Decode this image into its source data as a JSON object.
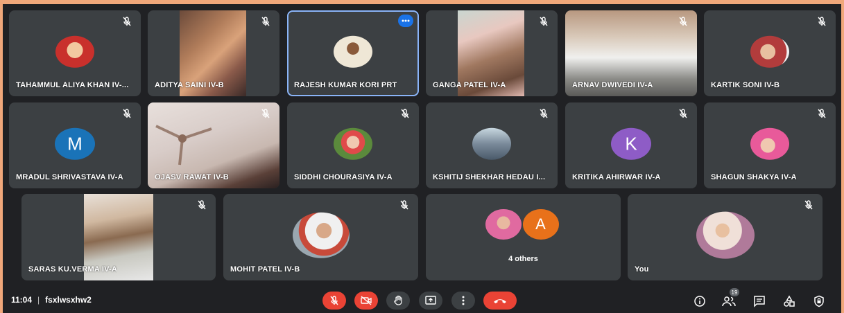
{
  "participants_row1": [
    {
      "name": "TAHAMMUL ALIYA KHAN IV-...",
      "avatar_color": "#c9302c"
    },
    {
      "name": "ADITYA SAINI IV-B"
    },
    {
      "name": "RAJESH KUMAR KORI PRT",
      "avatar_color": "#d8c9a7"
    },
    {
      "name": "GANGA PATEL IV-A"
    },
    {
      "name": "ARNAV DWIVEDI IV-A"
    },
    {
      "name": "KARTIK SONI IV-B",
      "avatar_color": "#b23c3c"
    }
  ],
  "participants_row2": [
    {
      "name": "MRADUL SHRIVASTAVA IV-A",
      "initial": "M",
      "avatar_color": "#1a73b8"
    },
    {
      "name": "OJASV RAWAT IV-B"
    },
    {
      "name": "SIDDHI CHOURASIYA IV-A",
      "avatar_color": "#5b8a3c"
    },
    {
      "name": "KSHITIJ SHEKHAR HEDAU I...",
      "avatar_color": "#7a8a9a"
    },
    {
      "name": "KRITIKA AHIRWAR IV-A",
      "initial": "K",
      "avatar_color": "#8e5cc6"
    },
    {
      "name": "SHAGUN SHAKYA IV-A",
      "avatar_color": "#e85a9a"
    }
  ],
  "participants_row3": [
    {
      "name": "SARAS KU.VERMA IV-A"
    },
    {
      "name": "MOHIT PATEL IV-B",
      "avatar_color": "#9aa7b0"
    },
    {
      "name": "4 others",
      "initial": "A",
      "avatar_color": "#e8711a"
    },
    {
      "name": "You",
      "avatar_color": "#b07a9a"
    }
  ],
  "meeting": {
    "time": "11:04",
    "separator": "|",
    "code": "fsxlwsxhw2",
    "people_count": "19"
  },
  "colors": {
    "tile_bg": "#3c4043",
    "stage_bg": "#202124",
    "accent_blue": "#1a73e8",
    "red": "#ea4335"
  },
  "icons": {
    "mic_off": "mic-off-icon",
    "camera_off": "camera-off-icon",
    "raise_hand": "raise-hand-icon",
    "present": "present-screen-icon",
    "more": "more-options-icon",
    "hang_up": "hang-up-icon",
    "info": "info-icon",
    "people": "people-icon",
    "chat": "chat-icon",
    "activities": "activities-icon",
    "host_controls": "host-controls-icon"
  }
}
